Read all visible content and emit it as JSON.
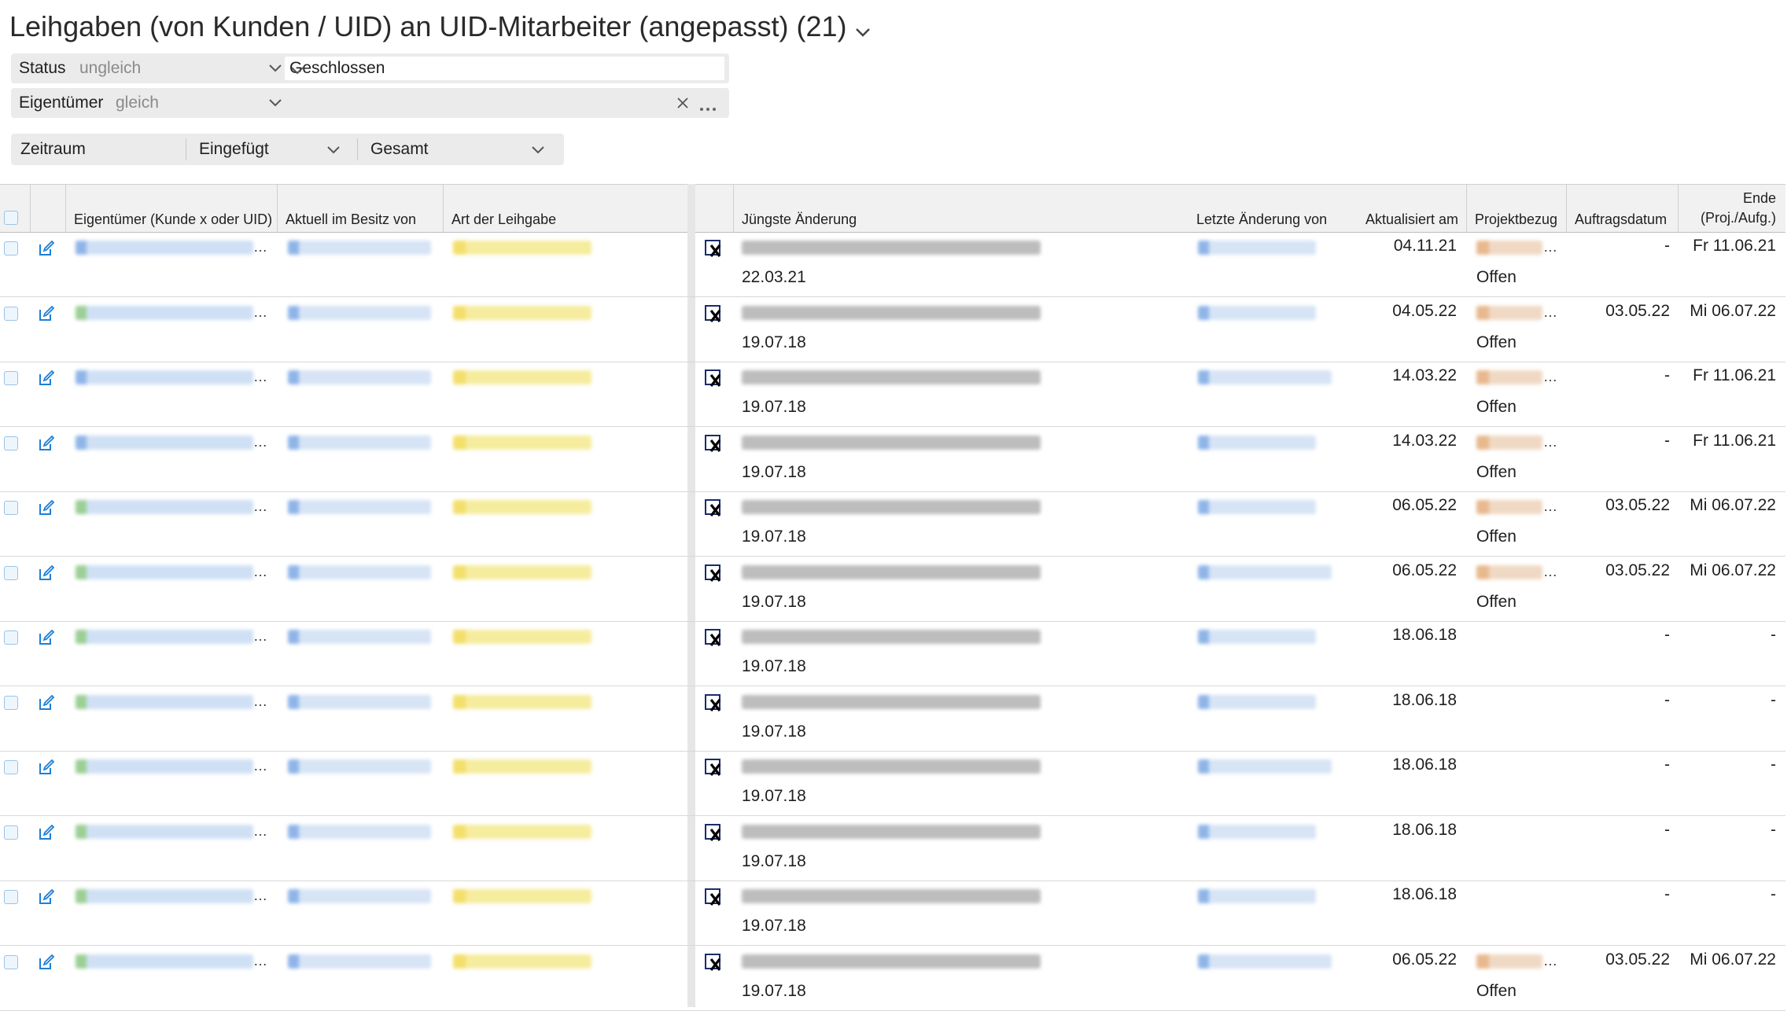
{
  "title": "Leihgaben (von Kunden / UID) an UID-Mitarbeiter (angepasst) (21)",
  "filters": [
    {
      "label": "Status",
      "operator": "ungleich",
      "value": "Geschlossen"
    },
    {
      "label": "Eigentümer",
      "operator": "gleich",
      "value": ""
    }
  ],
  "range": {
    "label": "Zeitraum",
    "field": "Eingefügt",
    "period": "Gesamt"
  },
  "columns": {
    "owner": "Eigentümer (Kunde x oder UID)",
    "holder": "Aktuell im Besitz von",
    "type": "Art der Leihgabe",
    "latest": "Jüngste Änderung",
    "changed_by": "Letzte Änderung von",
    "updated": "Aktualisiert am",
    "project": "Projektbezug",
    "order_date": "Auftragsdatum",
    "end_line1": "Ende",
    "end_line2": "(Proj./Aufg.)"
  },
  "rows": [
    {
      "date": "22.03.21",
      "updated": "04.11.21",
      "status": "Offen",
      "order": "-",
      "end": "Fr 11.06.21",
      "owner_color": "#8fb5e8",
      "holder_color": "#8fb5e8",
      "changer_color": "#8fb5e8",
      "project_color": "#e8b98f"
    },
    {
      "date": "19.07.18",
      "updated": "04.05.22",
      "status": "Offen",
      "order": "03.05.22",
      "end": "Mi 06.07.22",
      "owner_color": "#9ccf95",
      "holder_color": "#8fb5e8",
      "changer_color": "#8fb5e8",
      "project_color": "#e8b98f"
    },
    {
      "date": "19.07.18",
      "updated": "14.03.22",
      "status": "Offen",
      "order": "-",
      "end": "Fr 11.06.21",
      "owner_color": "#8fb5e8",
      "holder_color": "#8fb5e8",
      "changer_color": "#8fb5e8",
      "project_color": "#e8b98f"
    },
    {
      "date": "19.07.18",
      "updated": "14.03.22",
      "status": "Offen",
      "order": "-",
      "end": "Fr 11.06.21",
      "owner_color": "#8fb5e8",
      "holder_color": "#8fb5e8",
      "changer_color": "#8fb5e8",
      "project_color": "#e8b98f"
    },
    {
      "date": "19.07.18",
      "updated": "06.05.22",
      "status": "Offen",
      "order": "03.05.22",
      "end": "Mi 06.07.22",
      "owner_color": "#9ccf95",
      "holder_color": "#8fb5e8",
      "changer_color": "#8fb5e8",
      "project_color": "#e8b98f"
    },
    {
      "date": "19.07.18",
      "updated": "06.05.22",
      "status": "Offen",
      "order": "03.05.22",
      "end": "Mi 06.07.22",
      "owner_color": "#9ccf95",
      "holder_color": "#8fb5e8",
      "changer_color": "#8fb5e8",
      "project_color": "#e8b98f"
    },
    {
      "date": "19.07.18",
      "updated": "18.06.18",
      "status": "",
      "order": "-",
      "end": "-",
      "owner_color": "#9ccf95",
      "holder_color": "#8fb5e8",
      "changer_color": "#8fb5e8",
      "project_color": ""
    },
    {
      "date": "19.07.18",
      "updated": "18.06.18",
      "status": "",
      "order": "-",
      "end": "-",
      "owner_color": "#9ccf95",
      "holder_color": "#8fb5e8",
      "changer_color": "#8fb5e8",
      "project_color": ""
    },
    {
      "date": "19.07.18",
      "updated": "18.06.18",
      "status": "",
      "order": "-",
      "end": "-",
      "owner_color": "#9ccf95",
      "holder_color": "#8fb5e8",
      "changer_color": "#8fb5e8",
      "project_color": ""
    },
    {
      "date": "19.07.18",
      "updated": "18.06.18",
      "status": "",
      "order": "-",
      "end": "-",
      "owner_color": "#9ccf95",
      "holder_color": "#8fb5e8",
      "changer_color": "#8fb5e8",
      "project_color": ""
    },
    {
      "date": "19.07.18",
      "updated": "18.06.18",
      "status": "",
      "order": "-",
      "end": "-",
      "owner_color": "#9ccf95",
      "holder_color": "#8fb5e8",
      "changer_color": "#8fb5e8",
      "project_color": ""
    },
    {
      "date": "19.07.18",
      "updated": "06.05.22",
      "status": "Offen",
      "order": "03.05.22",
      "end": "Mi 06.07.22",
      "owner_color": "#9ccf95",
      "holder_color": "#8fb5e8",
      "changer_color": "#8fb5e8",
      "project_color": "#e8b98f"
    }
  ],
  "colors": {
    "accent": "#1e7fd6",
    "type_badge": "#f3df6b",
    "header_bg": "#f1f1f1"
  },
  "icons": {
    "edit": "edit-icon",
    "latest": "document-x-icon",
    "dropdown": "chevron-down-icon",
    "clear": "clear-icon",
    "more": "more-icon"
  }
}
